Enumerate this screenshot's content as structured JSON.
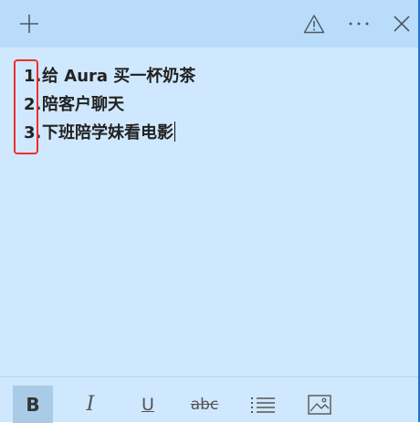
{
  "titlebar": {
    "icons": [
      "plus-icon",
      "warning-icon",
      "more-icon",
      "close-icon"
    ]
  },
  "note": {
    "items": [
      {
        "number": "1.",
        "text": "给 Aura 买一杯奶茶"
      },
      {
        "number": "2.",
        "text": "陪客户聊天"
      },
      {
        "number": "3.",
        "text": "下班陪学妹看电影"
      }
    ]
  },
  "toolbar": {
    "bold_label": "B",
    "italic_label": "I",
    "underline_label": "U",
    "strikethrough_label": "abc",
    "icons": [
      "bullet-list-icon",
      "image-icon"
    ]
  },
  "colors": {
    "titlebar": "#b9dcfb",
    "note_background": "#cfe8fd",
    "active_button": "#a9cbe8",
    "highlight_box": "#ef2f2f",
    "window_border": "#1f73d1"
  }
}
